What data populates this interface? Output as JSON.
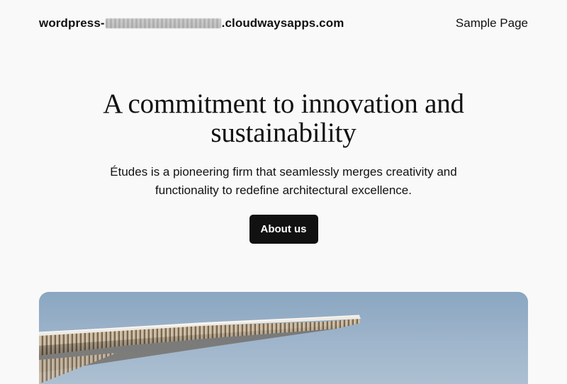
{
  "header": {
    "site_title_prefix": "wordpress-",
    "site_title_suffix": ".cloudwaysapps.com",
    "nav": [
      {
        "label": "Sample Page"
      }
    ]
  },
  "hero": {
    "heading": "A commitment to innovation and sustainability",
    "text": "Études is a pioneering firm that seamlessly merges creativity and functionality to redefine architectural excellence.",
    "button_label": "About us"
  },
  "colors": {
    "background": "#f9f9f9",
    "text": "#111111",
    "button_bg": "#111111",
    "button_text": "#ffffff",
    "sky": "#9fb5cb"
  }
}
